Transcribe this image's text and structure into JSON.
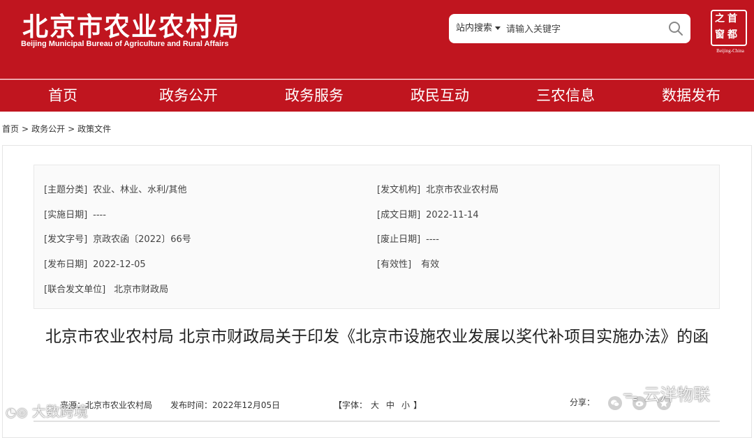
{
  "header": {
    "site_name": "北京市农业农村局",
    "site_name_en": "Beijing Municipal Bureau of Agriculture and Rural Affairs",
    "search": {
      "scope_label": "站内搜索",
      "placeholder": "请输入关键字"
    },
    "capital_logo": {
      "chars": [
        "首",
        "都",
        "之",
        "窗"
      ],
      "english": "Beijing-China"
    }
  },
  "nav": {
    "items": [
      "首页",
      "政务公开",
      "政务服务",
      "政民互动",
      "三农信息",
      "数据发布"
    ]
  },
  "breadcrumb": {
    "items": [
      "首页",
      "政务公开",
      "政策文件"
    ],
    "separator": ">"
  },
  "meta": {
    "topic_label": "[主题分类]",
    "topic_value": "农业、林业、水利/其他",
    "issuer_label": "[发文机构]",
    "issuer_value": "北京市农业农村局",
    "effective_date_label": "[实施日期]",
    "effective_date_value": "----",
    "written_date_label": "[成文日期]",
    "written_date_value": "2022-11-14",
    "doc_number_label": "[发文字号]",
    "doc_number_value": "京政农函〔2022〕66号",
    "repeal_date_label": "[废止日期]",
    "repeal_date_value": "----",
    "publish_date_label": "[发布日期]",
    "publish_date_value": "2022-12-05",
    "validity_label": "[有效性]",
    "validity_value": "有效",
    "joint_issuer_label": "[联合发文单位]",
    "joint_issuer_value": "北京市财政局"
  },
  "article": {
    "title": "北京市农业农村局 北京市财政局关于印发《北京市设施农业发展以奖代补项目实施办法》的函",
    "source_label": "来源：",
    "source_value": "北京市农业农村局",
    "time_label": "发布时间：",
    "time_value": "2022年12月05日",
    "font_size_label": "【字体：",
    "font_sizes": [
      "大",
      "中",
      "小"
    ],
    "font_size_close": "】",
    "share_label": "分享："
  },
  "share_icons": [
    "wechat-icon",
    "weibo-icon",
    "qzone-icon"
  ],
  "watermarks": {
    "left": "大数跨境",
    "right": "云洋物联"
  },
  "colors": {
    "brand_red": "#c0151f",
    "meta_bg": "#fafafa"
  }
}
